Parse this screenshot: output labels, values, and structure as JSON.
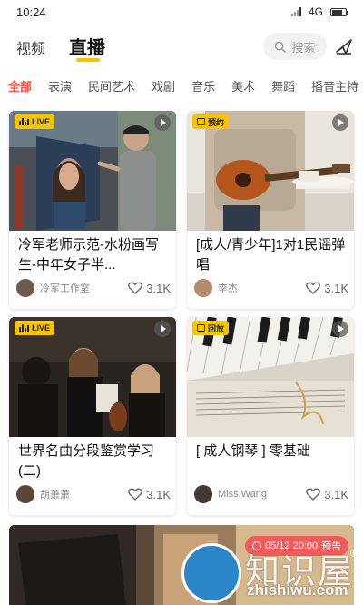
{
  "status_bar": {
    "time": "10:24",
    "network": "4G"
  },
  "header": {
    "tabs": [
      {
        "label": "视频"
      },
      {
        "label": "直播"
      }
    ],
    "active_tab": "直播",
    "search_placeholder": "搜索",
    "accent_color": "#f7c400"
  },
  "categories": [
    "全部",
    "表演",
    "民间艺术",
    "戏剧",
    "音乐",
    "美术",
    "舞蹈",
    "播音主持"
  ],
  "active_category": "全部",
  "cards": [
    {
      "badge": "LIVE",
      "badge_type": "live",
      "title": "冷军老师示范-水粉画写生-中年女子半...",
      "author": "冷军工作室",
      "likes": "3.1K"
    },
    {
      "badge": "预约",
      "badge_type": "reserve",
      "title": "[成人/青少年]1对1民谣弹唱",
      "author": "李杰",
      "likes": "3.1K"
    },
    {
      "badge": "LIVE",
      "badge_type": "live",
      "title": "世界名曲分段鉴赏学习(二)",
      "author": "胡萧萧",
      "likes": "3.1K"
    },
    {
      "badge": "回放",
      "badge_type": "replay",
      "title": "[ 成人钢琴 ] 零基础",
      "author": "Miss.Wang",
      "likes": "3.1K"
    }
  ],
  "bottom_card": {
    "time_badge": "05/12 20:00",
    "badge_label": "预告"
  },
  "watermark": {
    "brand": "知识屋",
    "url": "zhishiwu.com",
    "mark": "®"
  }
}
